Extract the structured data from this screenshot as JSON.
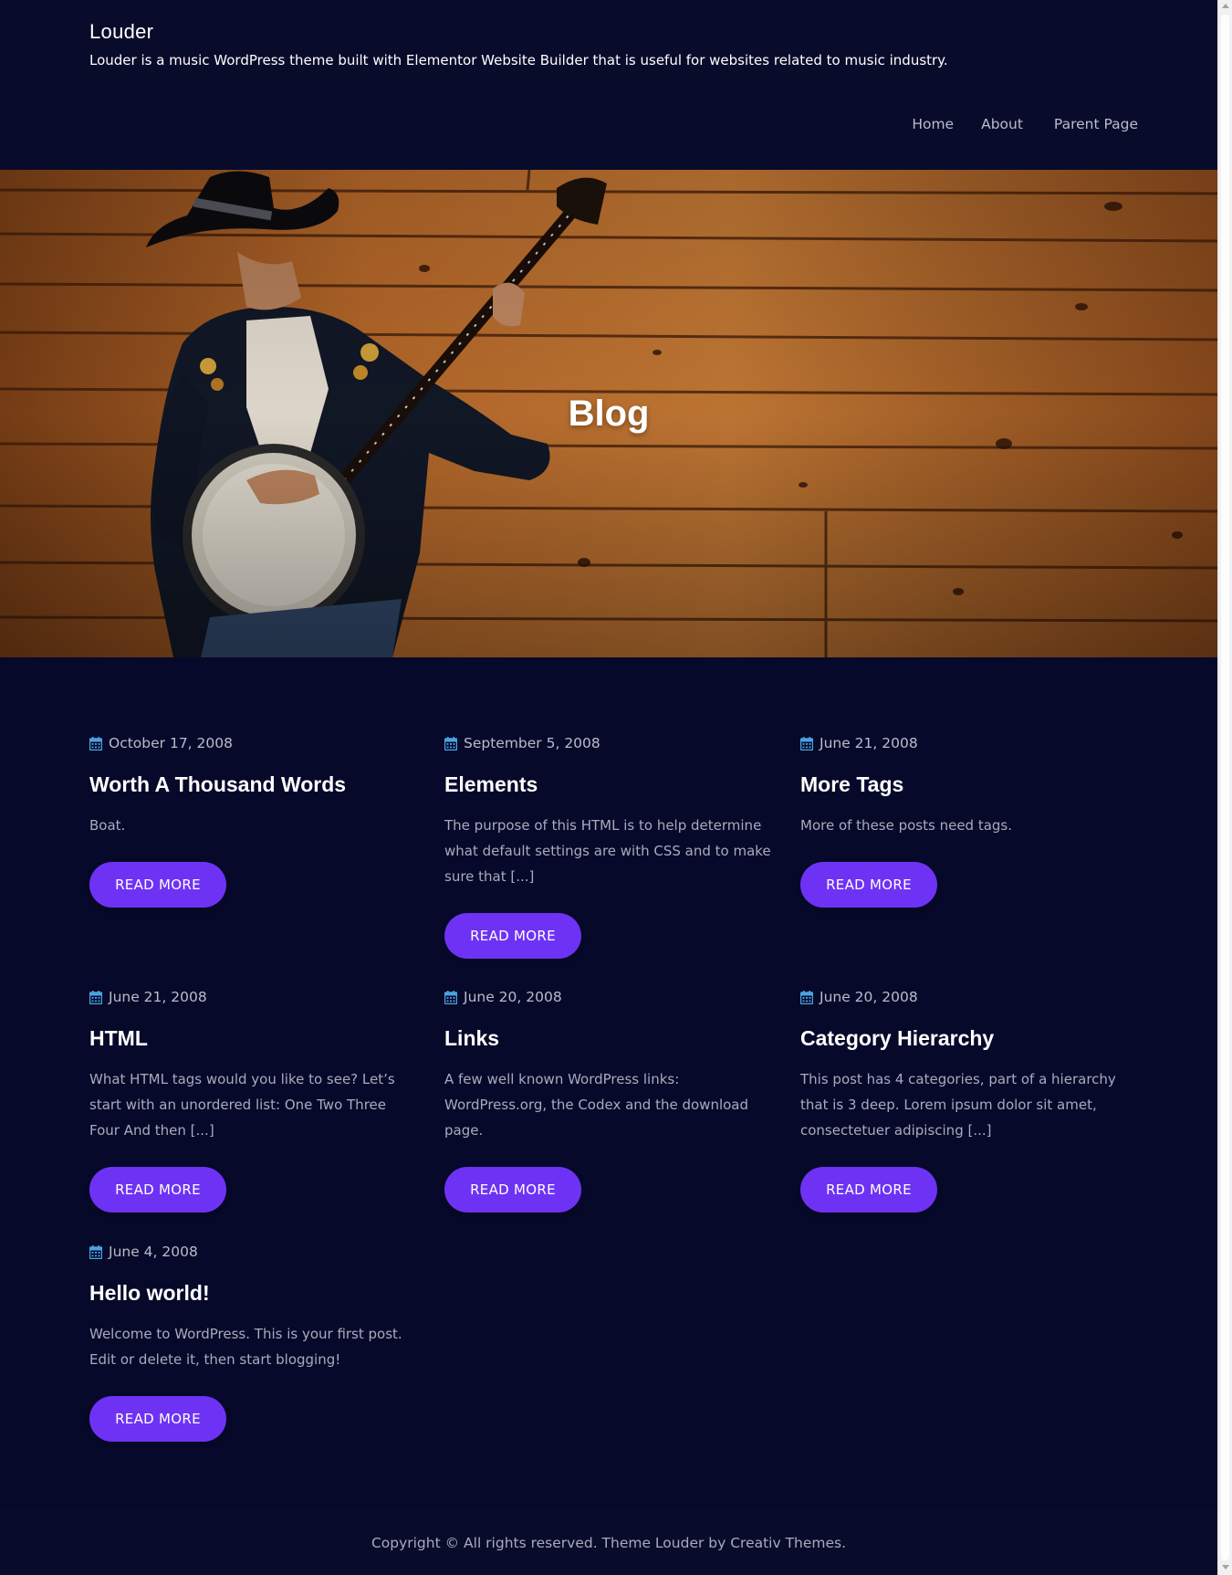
{
  "site": {
    "title": "Louder",
    "description": "Louder is a music WordPress theme built with Elementor Website Builder that is useful for websites related to music industry."
  },
  "nav": {
    "items": [
      {
        "label": "Home"
      },
      {
        "label": "About"
      },
      {
        "label": "Parent Page"
      }
    ]
  },
  "hero": {
    "title": "Blog"
  },
  "posts": [
    {
      "date": "October 17, 2008",
      "title": "Worth A Thousand Words",
      "excerpt": "Boat.",
      "button": "READ MORE"
    },
    {
      "date": "September 5, 2008",
      "title": "Elements",
      "excerpt": "The purpose of this HTML is to help determine what default settings are with CSS and to make sure that [...]",
      "button": "READ MORE"
    },
    {
      "date": "June 21, 2008",
      "title": "More Tags",
      "excerpt": "More of these posts need tags.",
      "button": "READ MORE"
    },
    {
      "date": "June 21, 2008",
      "title": "HTML",
      "excerpt": "What HTML tags would you like to see? Let’s start with an unordered list: One Two Three Four And then [...]",
      "button": "READ MORE"
    },
    {
      "date": "June 20, 2008",
      "title": "Links",
      "excerpt": "A few well known WordPress links: WordPress.org, the Codex and the download page.",
      "button": "READ MORE"
    },
    {
      "date": "June 20, 2008",
      "title": "Category Hierarchy",
      "excerpt": "This post has 4 categories, part of a hierarchy that is 3 deep. Lorem ipsum dolor sit amet, consectetuer adipiscing [...]",
      "button": "READ MORE"
    },
    {
      "date": "June 4, 2008",
      "title": "Hello world!",
      "excerpt": "Welcome to WordPress. This is your first post. Edit or delete it, then start blogging!",
      "button": "READ MORE"
    }
  ],
  "footer": {
    "copyright": "Copyright © All rights reserved. Theme Louder by Creativ Themes."
  },
  "icons": {
    "date": "calendar-icon"
  },
  "colors": {
    "background": "#07092a",
    "accent": "#6e32f5",
    "calendar_icon": "#4aa3e0",
    "heading": "#ffffff",
    "text": "#b9bccb"
  }
}
